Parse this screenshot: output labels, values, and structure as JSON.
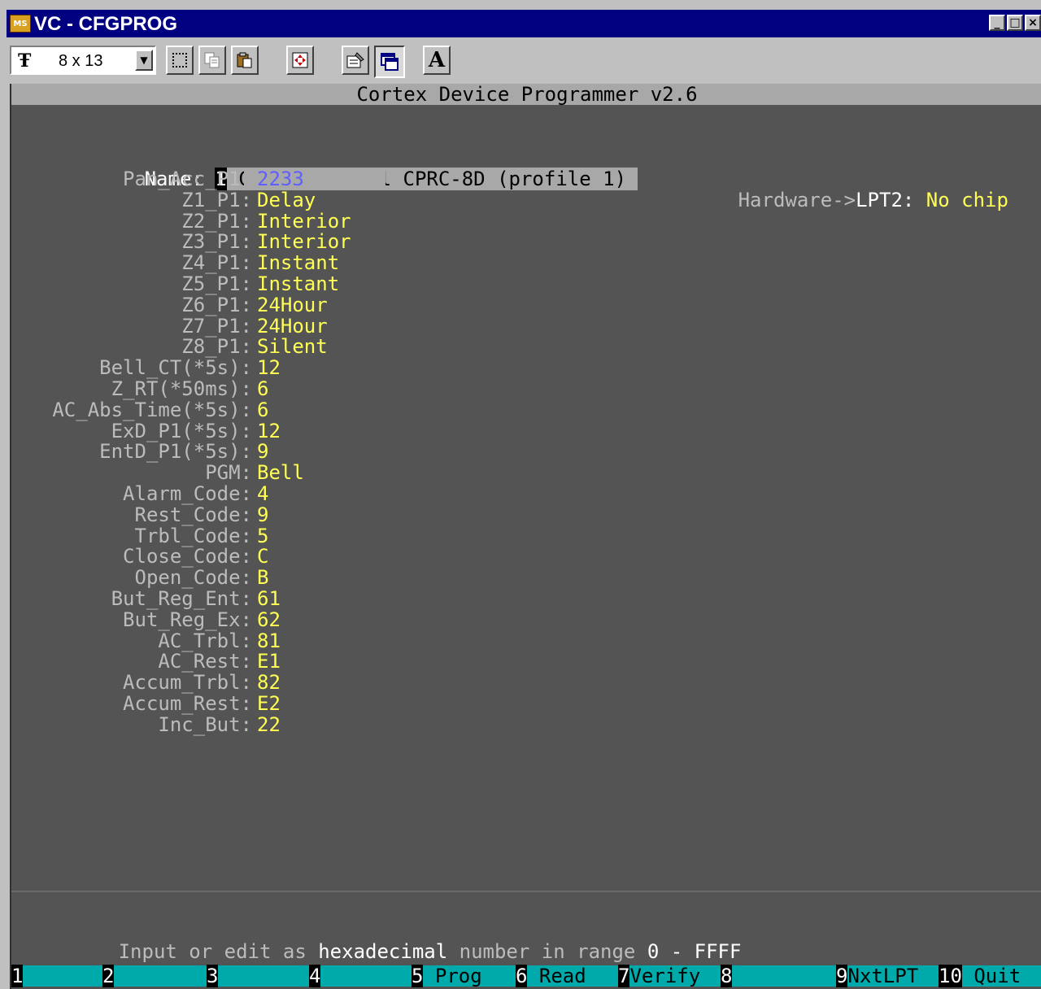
{
  "window": {
    "title": "VC - CFGPROG",
    "icon_text": "MS",
    "buttons": [
      "_",
      "□",
      "×"
    ]
  },
  "toolbar": {
    "font_size": "8 x 13",
    "font_icon": "Ŧ",
    "icons": [
      "mark-icon",
      "copy-icon",
      "paste-icon",
      "fullscreen-icon",
      "properties-icon",
      "background-icon",
      "font-icon"
    ],
    "font_button_glyph": "A"
  },
  "console": {
    "header": "Cortex Device Programmer v2.6",
    "name_label": "Name: ",
    "name_index": "1",
    "name_value": " Control panel CPRC-8D (profile 1) ",
    "hardware_label": "Hardware->",
    "hardware_port": "LPT2:",
    "hardware_status": "No chip",
    "fields": [
      {
        "label": "Pan_Acc_P1:",
        "value": "2233"
      },
      {
        "label": "Z1_P1:",
        "value": "Delay"
      },
      {
        "label": "Z2_P1:",
        "value": "Interior"
      },
      {
        "label": "Z3_P1:",
        "value": "Interior"
      },
      {
        "label": "Z4_P1:",
        "value": "Instant"
      },
      {
        "label": "Z5_P1:",
        "value": "Instant"
      },
      {
        "label": "Z6_P1:",
        "value": "24Hour"
      },
      {
        "label": "Z7_P1:",
        "value": "24Hour"
      },
      {
        "label": "Z8_P1:",
        "value": "Silent"
      },
      {
        "label": "Bell_CT(*5s):",
        "value": "12"
      },
      {
        "label": "Z_RT(*50ms):",
        "value": "6"
      },
      {
        "label": "AC_Abs_Time(*5s):",
        "value": "6"
      },
      {
        "label": "ExD_P1(*5s):",
        "value": "12"
      },
      {
        "label": "EntD_P1(*5s):",
        "value": "9"
      },
      {
        "label": "PGM:",
        "value": "Bell"
      },
      {
        "label": "Alarm_Code:",
        "value": "4"
      },
      {
        "label": "Rest_Code:",
        "value": "9"
      },
      {
        "label": "Trbl_Code:",
        "value": "5"
      },
      {
        "label": "Close_Code:",
        "value": "C"
      },
      {
        "label": "Open_Code:",
        "value": "B"
      },
      {
        "label": "But_Reg_Ent:",
        "value": "61"
      },
      {
        "label": "But_Reg_Ex:",
        "value": "62"
      },
      {
        "label": "AC_Trbl:",
        "value": "81"
      },
      {
        "label": "AC_Rest:",
        "value": "E1"
      },
      {
        "label": "Accum_Trbl:",
        "value": "82"
      },
      {
        "label": "Accum_Rest:",
        "value": "E2"
      },
      {
        "label": "Inc_But:",
        "value": "22"
      }
    ],
    "status": {
      "part1": "Input or edit as ",
      "part2": "hexadecimal",
      "part3": " number in range ",
      "part4": "0 - FFFF"
    },
    "fkeys": [
      {
        "num": "1",
        "label": ""
      },
      {
        "num": "2",
        "label": ""
      },
      {
        "num": "3",
        "label": ""
      },
      {
        "num": "4",
        "label": ""
      },
      {
        "num": "5",
        "label": " Prog"
      },
      {
        "num": "6",
        "label": " Read"
      },
      {
        "num": "7",
        "label": "Verify"
      },
      {
        "num": "8",
        "label": ""
      },
      {
        "num": "9",
        "label": "NxtLPT"
      },
      {
        "num": "10",
        "label": " Quit"
      }
    ],
    "colors": {
      "background": "#545454",
      "label": "#bcbcbc",
      "value": "#ffff55",
      "selected_value": "#5f5fff",
      "fkey_bar": "#00aaaa"
    }
  }
}
